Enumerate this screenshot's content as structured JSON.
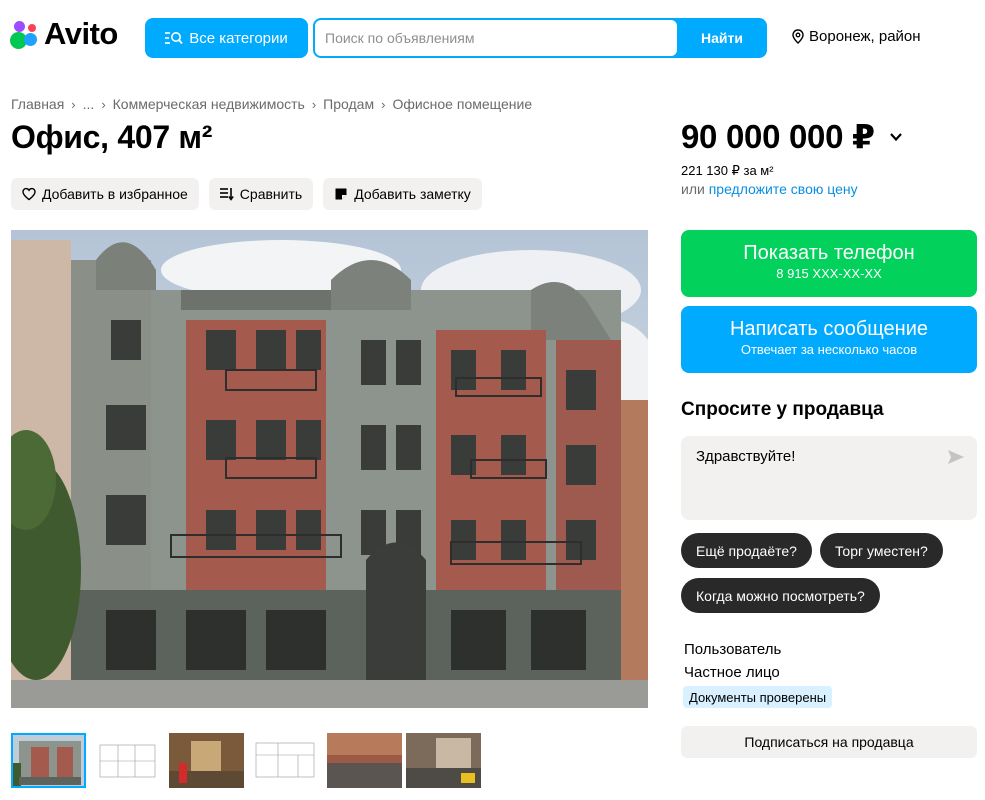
{
  "header": {
    "logo_text": "Avito",
    "categories_button": "Все категории",
    "search_placeholder": "Поиск по объявлениям",
    "search_button": "Найти",
    "location": "Воронеж, район"
  },
  "breadcrumb": [
    "Главная",
    "...",
    "Коммерческая недвижимость",
    "Продам",
    "Офисное помещение"
  ],
  "listing": {
    "title": "Офис, 407 м²",
    "actions": {
      "favorite": "Добавить в избранное",
      "compare": "Сравнить",
      "note": "Добавить заметку"
    }
  },
  "pricing": {
    "price": "90 000 000 ₽",
    "price_per_m": "221 130 ₽ за м²",
    "offer_prefix": "или",
    "offer_link": "предложите свою цену"
  },
  "contact": {
    "phone_label": "Показать телефон",
    "phone_masked": "8 915 XXX-XX-XX",
    "message_label": "Написать сообщение",
    "message_sub": "Отвечает за несколько часов"
  },
  "ask_seller": {
    "title": "Спросите у продавца",
    "message_value": "Здравствуйте!",
    "quick_questions": [
      "Ещё продаёте?",
      "Торг уместен?",
      "Когда можно посмотреть?"
    ]
  },
  "seller": {
    "name": "Пользователь",
    "type": "Частное лицо",
    "badge": "Документы проверены",
    "subscribe": "Подписаться на продавца"
  },
  "colors": {
    "brand_blue": "#00aaff",
    "phone_green": "#02d15c",
    "link_blue": "#0a8ee0"
  }
}
